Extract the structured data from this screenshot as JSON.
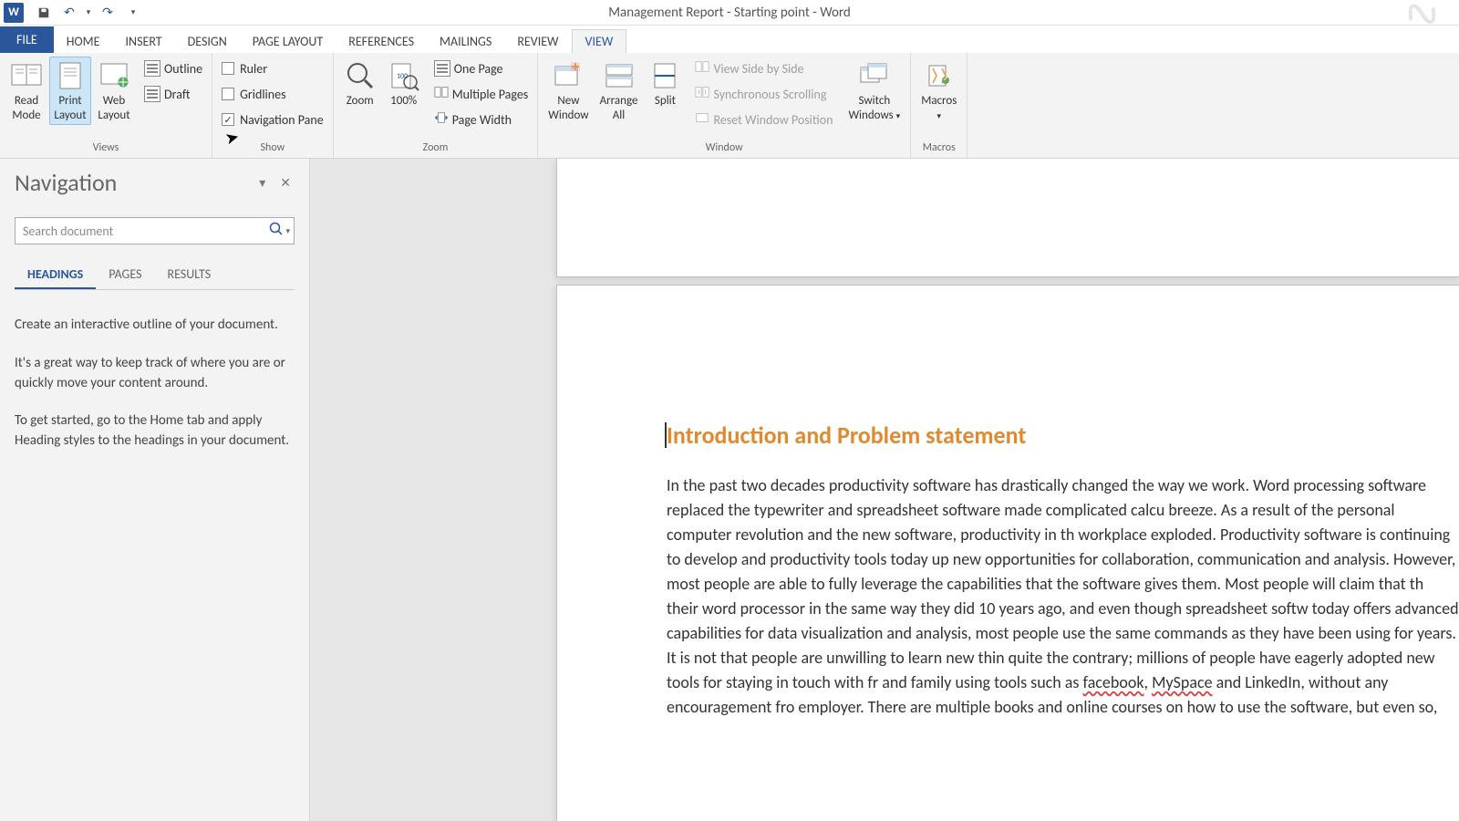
{
  "title": "Management Report - Starting point - Word",
  "tabs": {
    "file": "FILE",
    "home": "HOME",
    "insert": "INSERT",
    "design": "DESIGN",
    "pagelayout": "PAGE LAYOUT",
    "references": "REFERENCES",
    "mailings": "MAILINGS",
    "review": "REVIEW",
    "view": "VIEW"
  },
  "ribbon": {
    "views": {
      "read_mode": "Read\nMode",
      "print_layout": "Print\nLayout",
      "web_layout": "Web\nLayout",
      "outline": "Outline",
      "draft": "Draft",
      "label": "Views"
    },
    "show": {
      "ruler": {
        "label": "Ruler",
        "checked": false
      },
      "gridlines": {
        "label": "Gridlines",
        "checked": false
      },
      "navpane": {
        "label": "Navigation Pane",
        "checked": true
      },
      "label": "Show"
    },
    "zoom": {
      "zoom": "Zoom",
      "hundred": "100%",
      "one_page": "One Page",
      "multiple_pages": "Multiple Pages",
      "page_width": "Page Width",
      "label": "Zoom"
    },
    "window": {
      "new_window": "New\nWindow",
      "arrange_all": "Arrange\nAll",
      "split": "Split",
      "view_side": "View Side by Side",
      "sync_scroll": "Synchronous Scrolling",
      "reset_pos": "Reset Window Position",
      "switch_windows": "Switch\nWindows",
      "label": "Window"
    },
    "macros": {
      "macros": "Macros",
      "label": "Macros"
    }
  },
  "nav": {
    "title": "Navigation",
    "search_placeholder": "Search document",
    "tabs": {
      "headings": "Headings",
      "pages": "Pages",
      "results": "Results"
    },
    "p1": "Create an interactive outline of your document.",
    "p2": "It's a great way to keep track of where you are or quickly move your content around.",
    "p3": "To get started, go to the Home tab and apply Heading styles to the headings in your document."
  },
  "doc": {
    "heading": "Introduction and Problem statement",
    "body_a": "In the past two decades productivity software has drastically changed the way we work. Word processing software replaced the typewriter and spreadsheet software made complicated calcu",
    "body_b": " breeze. As a result of the personal computer revolution and the new software, productivity in th",
    "body_c": " workplace exploded. Productivity software is continuing to develop and productivity tools today",
    "body_d": " up new opportunities for collaboration, communication and analysis. However, most people are",
    "body_e": " able to fully leverage the capabilities that the software gives them. Most people will claim that th",
    "body_f": " their word processor in the same way they did 10 years ago, and even though spreadsheet softw",
    "body_g": " today offers advanced capabilities for data visualization and analysis, most people use the same",
    "body_h": " commands as they have been using for years. It is not that people are unwilling to learn new thin",
    "body_i": " quite the contrary; millions of people have eagerly adopted new tools for staying in touch with fr",
    "body_j": " and family using tools such as ",
    "body_k": ", ",
    "body_l": " and LinkedIn, without any encouragement fro",
    "body_m": " employer. There are multiple books and online courses on how to use the software, but even so,",
    "err1": "facebook",
    "err2": "MySpace"
  }
}
